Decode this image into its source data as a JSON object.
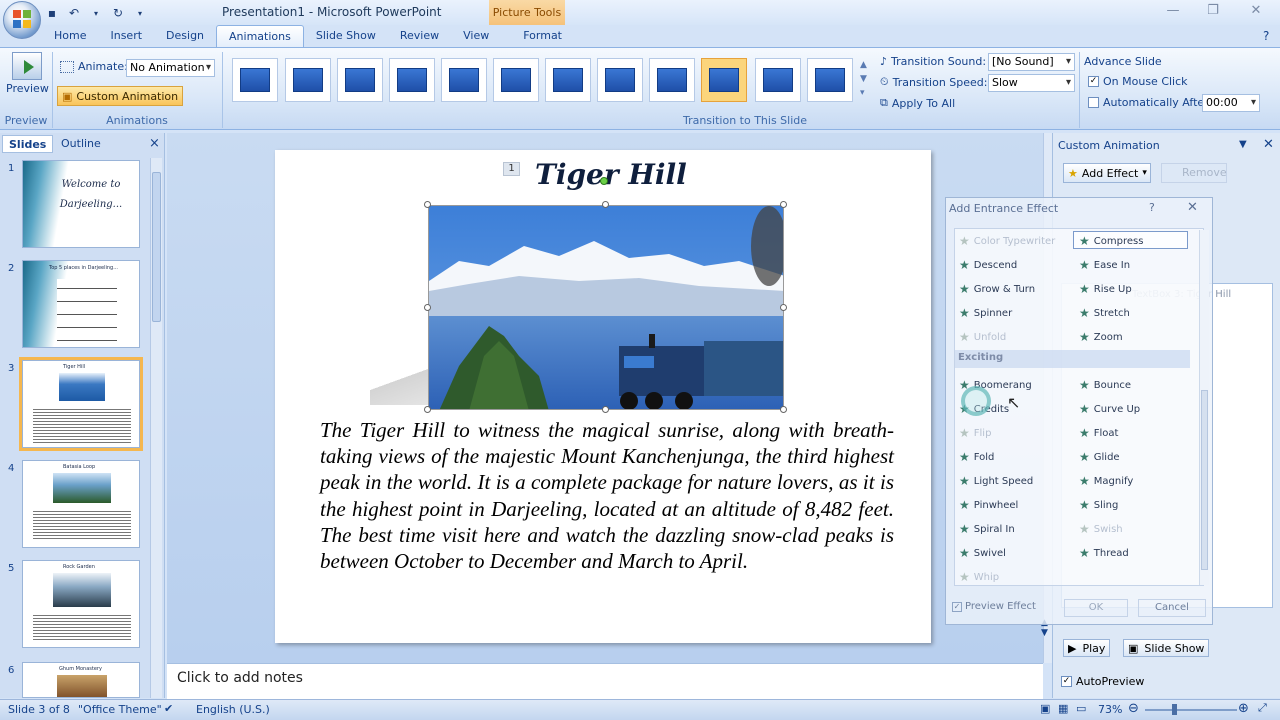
{
  "window": {
    "title": "Presentation1 - Microsoft PowerPoint",
    "context_tab": "Picture Tools"
  },
  "tabs": [
    "Home",
    "Insert",
    "Design",
    "Animations",
    "Slide Show",
    "Review",
    "View",
    "Format"
  ],
  "ribbon": {
    "preview_label": "Preview",
    "preview_group": "Preview",
    "animate_label": "Animate:",
    "animate_value": "No Animation",
    "custom_animation": "Custom Animation",
    "animations_group": "Animations",
    "transition_group": "Transition to This Slide",
    "transition_sound_label": "Transition Sound:",
    "transition_sound_value": "[No Sound]",
    "transition_speed_label": "Transition Speed:",
    "transition_speed_value": "Slow",
    "apply_to_all": "Apply To All",
    "advance_slide": "Advance Slide",
    "on_mouse_click": "On Mouse Click",
    "auto_after": "Automatically After:",
    "auto_after_value": "00:00"
  },
  "panel": {
    "tab_slides": "Slides",
    "tab_outline": "Outline",
    "close": "×",
    "slides": [
      {
        "num": "1",
        "title": "Welcome to Darjeeling..."
      },
      {
        "num": "2",
        "title": "Top 5 places in Darjeeling..."
      },
      {
        "num": "3",
        "title": "Tiger Hill"
      },
      {
        "num": "4",
        "title": "Batasia Loop"
      },
      {
        "num": "5",
        "title": "Rock Garden"
      },
      {
        "num": "6",
        "title": "Ghum Monastery"
      }
    ]
  },
  "slide": {
    "anim_tag": "1",
    "title": "Tiger Hill",
    "body": "The Tiger Hill to witness the magical sunrise, along with breath-taking views of the majestic Mount Kanchenjunga, the third highest peak in the world. It is a complete package for nature lovers, as it is the highest point in Darjeeling, located at an altitude of 8,482 feet. The best time visit here and watch the dazzling snow-clad peaks is between October to December and March to April."
  },
  "notes": "Click to add notes",
  "taskpane": {
    "title": "Custom Animation",
    "add_effect": "Add Effect",
    "remove": "Remove",
    "list_item": "TextBox 3: Tiger Hill",
    "play": "Play",
    "slide_show": "Slide Show",
    "autopreview": "AutoPreview"
  },
  "dialog": {
    "title": "Add Entrance Effect",
    "help": "?",
    "close": "✕",
    "col1": [
      "Color Typewriter",
      "Descend",
      "Grow & Turn",
      "Spinner",
      "Unfold"
    ],
    "col1_dim": [
      true,
      false,
      false,
      false,
      true
    ],
    "col2": [
      "Compress",
      "Ease In",
      "Rise Up",
      "Stretch",
      "Zoom"
    ],
    "section": "Exciting",
    "col3": [
      "Boomerang",
      "Credits",
      "Flip",
      "Fold",
      "Light Speed",
      "Pinwheel",
      "Spiral In",
      "Swivel",
      "Whip"
    ],
    "col3_dim": [
      false,
      false,
      true,
      false,
      false,
      false,
      false,
      false,
      true
    ],
    "col4": [
      "Bounce",
      "Curve Up",
      "Float",
      "Glide",
      "Magnify",
      "Sling",
      "Swish",
      "Thread"
    ],
    "col4_dim": [
      false,
      false,
      false,
      false,
      false,
      false,
      true,
      false
    ],
    "preview_effect": "Preview Effect",
    "ok": "OK",
    "cancel": "Cancel"
  },
  "status": {
    "slide_info": "Slide 3 of 8",
    "theme": "\"Office Theme\"",
    "language": "English (U.S.)",
    "zoom": "73%"
  }
}
